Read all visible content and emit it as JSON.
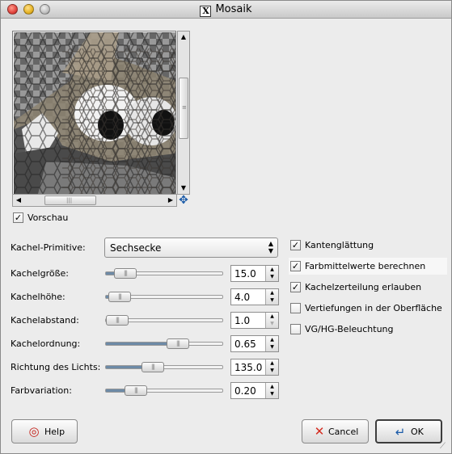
{
  "window": {
    "title": "Mosaik"
  },
  "preview": {
    "label": "Vorschau",
    "checked": true
  },
  "primitive": {
    "label": "Kachel-Primitive:",
    "value": "Sechsecke"
  },
  "sliders": [
    {
      "label": "Kachelgröße:",
      "value": "15.0",
      "level": 0.09
    },
    {
      "label": "Kachelhöhe:",
      "value": "4.0",
      "level": 0.03
    },
    {
      "label": "Kachelabstand:",
      "value": "1.0",
      "level": 0.0
    },
    {
      "label": "Kachelordnung:",
      "value": "0.65",
      "level": 0.65
    },
    {
      "label": "Richtung des Lichts:",
      "value": "135.0",
      "level": 0.375
    },
    {
      "label": "Farbvariation:",
      "value": "0.20",
      "level": 0.2
    }
  ],
  "options": [
    {
      "label": "Kantenglättung",
      "checked": true
    },
    {
      "label": "Farbmittelwerte berechnen",
      "checked": true
    },
    {
      "label": "Kachelzerteilung erlauben",
      "checked": true
    },
    {
      "label": "Vertiefungen in der Oberfläche",
      "checked": false
    },
    {
      "label": "VG/HG-Beleuchtung",
      "checked": false
    }
  ],
  "buttons": {
    "help": "Help",
    "cancel": "Cancel",
    "ok": "OK"
  },
  "icons": {
    "help": "lifebuoy-icon",
    "cancel": "red-x-icon",
    "ok": "enter-arrow-icon",
    "navigate": "move-arrows-icon"
  },
  "colors": {
    "slider_fill": "#6d8aa6",
    "accent": "#1a5aa8",
    "cancel": "#d42a1e"
  }
}
